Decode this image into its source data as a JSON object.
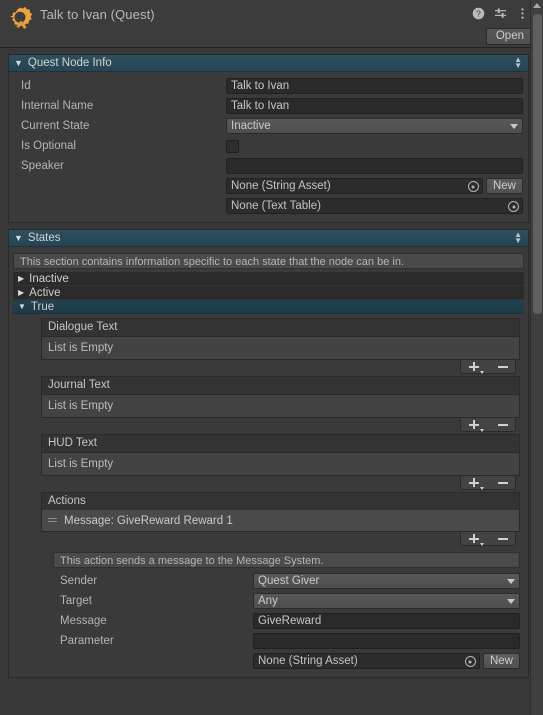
{
  "header": {
    "title": "Talk to Ivan (Quest)",
    "logo_icon": "quest-machine-gear-icon",
    "help_icon": "help-icon",
    "preset_icon": "preset-sliders-icon",
    "menu_icon": "kebab-menu-icon",
    "open_label": "Open"
  },
  "quest_node_info": {
    "foldout_label": "Quest Node Info",
    "fields": [
      {
        "label": "Id",
        "value": "Talk to Ivan",
        "type": "text"
      },
      {
        "label": "Internal Name",
        "value": "Talk to Ivan",
        "type": "text"
      },
      {
        "label": "Current State",
        "value": "Inactive",
        "type": "dropdown"
      },
      {
        "label": "Is Optional",
        "value": "",
        "type": "checkbox",
        "checked": false
      },
      {
        "label": "Speaker",
        "value": "",
        "type": "text"
      }
    ],
    "speaker_sub": [
      {
        "value": "None (String Asset)",
        "has_new": true,
        "new_label": "New"
      },
      {
        "value": "None (Text Table)",
        "has_new": false
      }
    ]
  },
  "states": {
    "foldout_label": "States",
    "help_text": "This section contains information specific to each state that the node can be in.",
    "rows": [
      {
        "label": "Inactive",
        "expanded": false
      },
      {
        "label": "Active",
        "expanded": false
      },
      {
        "label": "True",
        "expanded": true
      }
    ],
    "true_state": {
      "lists": [
        {
          "header": "Dialogue Text",
          "empty_label": "List is Empty",
          "items": []
        },
        {
          "header": "Journal Text",
          "empty_label": "List is Empty",
          "items": []
        },
        {
          "header": "HUD Text",
          "empty_label": "List is Empty",
          "items": []
        },
        {
          "header": "Actions",
          "empty_label": "",
          "items": [
            "Message: GiveReward  Reward 1"
          ]
        }
      ],
      "action_detail": {
        "help_text": "This action sends a message to the Message System.",
        "fields": [
          {
            "label": "Sender",
            "value": "Quest Giver",
            "type": "dropdown"
          },
          {
            "label": "Target",
            "value": "Any",
            "type": "dropdown"
          },
          {
            "label": "Message",
            "value": "GiveReward",
            "type": "text"
          },
          {
            "label": "Parameter",
            "value": "",
            "type": "text"
          }
        ],
        "object_row": {
          "value": "None (String Asset)",
          "new_label": "New"
        }
      }
    }
  },
  "colors": {
    "background": "#383838",
    "panel": "#3a3a3a",
    "foldout_blue": "#2e4f5e",
    "accent_orange": "#f0a030",
    "text": "#c4c4c4"
  }
}
